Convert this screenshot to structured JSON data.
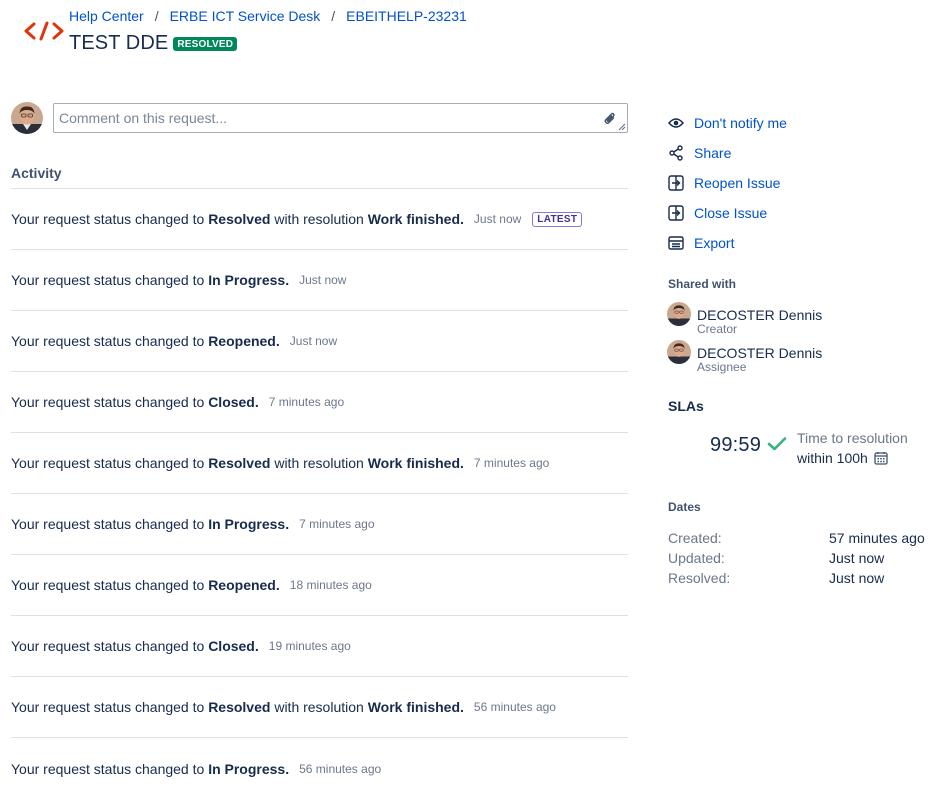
{
  "header": {
    "logo_icon": "code-brackets-icon",
    "breadcrumbs": [
      "Help Center",
      "ERBE ICT Service Desk",
      "EBEITHELP-23231"
    ],
    "separator": "/",
    "title": "TEST DDE",
    "status": "RESOLVED"
  },
  "comment": {
    "placeholder": "Comment on this request...",
    "attach_icon": "paperclip-icon"
  },
  "activity": {
    "heading": "Activity",
    "latest_badge": "LATEST",
    "prefix": "Your request status changed to",
    "with_resolution": "with resolution",
    "items": [
      {
        "status": "Resolved",
        "resolution": "Work finished.",
        "time": "Just now"
      },
      {
        "status": "In Progress.",
        "resolution": "",
        "time": "Just now"
      },
      {
        "status": "Reopened.",
        "resolution": "",
        "time": "Just now"
      },
      {
        "status": "Closed.",
        "resolution": "",
        "time": "7 minutes ago"
      },
      {
        "status": "Resolved",
        "resolution": "Work finished.",
        "time": "7 minutes ago"
      },
      {
        "status": "In Progress.",
        "resolution": "",
        "time": "7 minutes ago"
      },
      {
        "status": "Reopened.",
        "resolution": "",
        "time": "18 minutes ago"
      },
      {
        "status": "Closed.",
        "resolution": "",
        "time": "19 minutes ago"
      },
      {
        "status": "Resolved",
        "resolution": "Work finished.",
        "time": "56 minutes ago"
      },
      {
        "status": "In Progress.",
        "resolution": "",
        "time": "56 minutes ago"
      }
    ]
  },
  "sidebar": {
    "actions": [
      {
        "label": "Don't notify me",
        "icon": "eye-icon"
      },
      {
        "label": "Share",
        "icon": "share-icon"
      },
      {
        "label": "Reopen Issue",
        "icon": "transition-icon"
      },
      {
        "label": "Close Issue",
        "icon": "transition-icon"
      },
      {
        "label": "Export",
        "icon": "export-icon"
      }
    ],
    "shared_with": {
      "heading": "Shared with",
      "people": [
        {
          "name": "DECOSTER Dennis",
          "role": "Creator"
        },
        {
          "name": "DECOSTER Dennis",
          "role": "Assignee"
        }
      ]
    },
    "slas": {
      "heading": "SLAs",
      "value": "99:59",
      "goal_line1": "Time to resolution",
      "goal_line2": "within 100h"
    },
    "dates": {
      "heading": "Dates",
      "rows": [
        {
          "label": "Created:",
          "value": "57 minutes ago"
        },
        {
          "label": "Updated:",
          "value": "Just now"
        },
        {
          "label": "Resolved:",
          "value": "Just now"
        }
      ]
    }
  },
  "colors": {
    "link": "#0052cc",
    "text": "#172b4d",
    "muted": "#6b778c",
    "resolved_lozenge": "#00875a",
    "latest_badge_border": "#8777d9",
    "logo": "#de350b",
    "check": "#36b37e"
  }
}
